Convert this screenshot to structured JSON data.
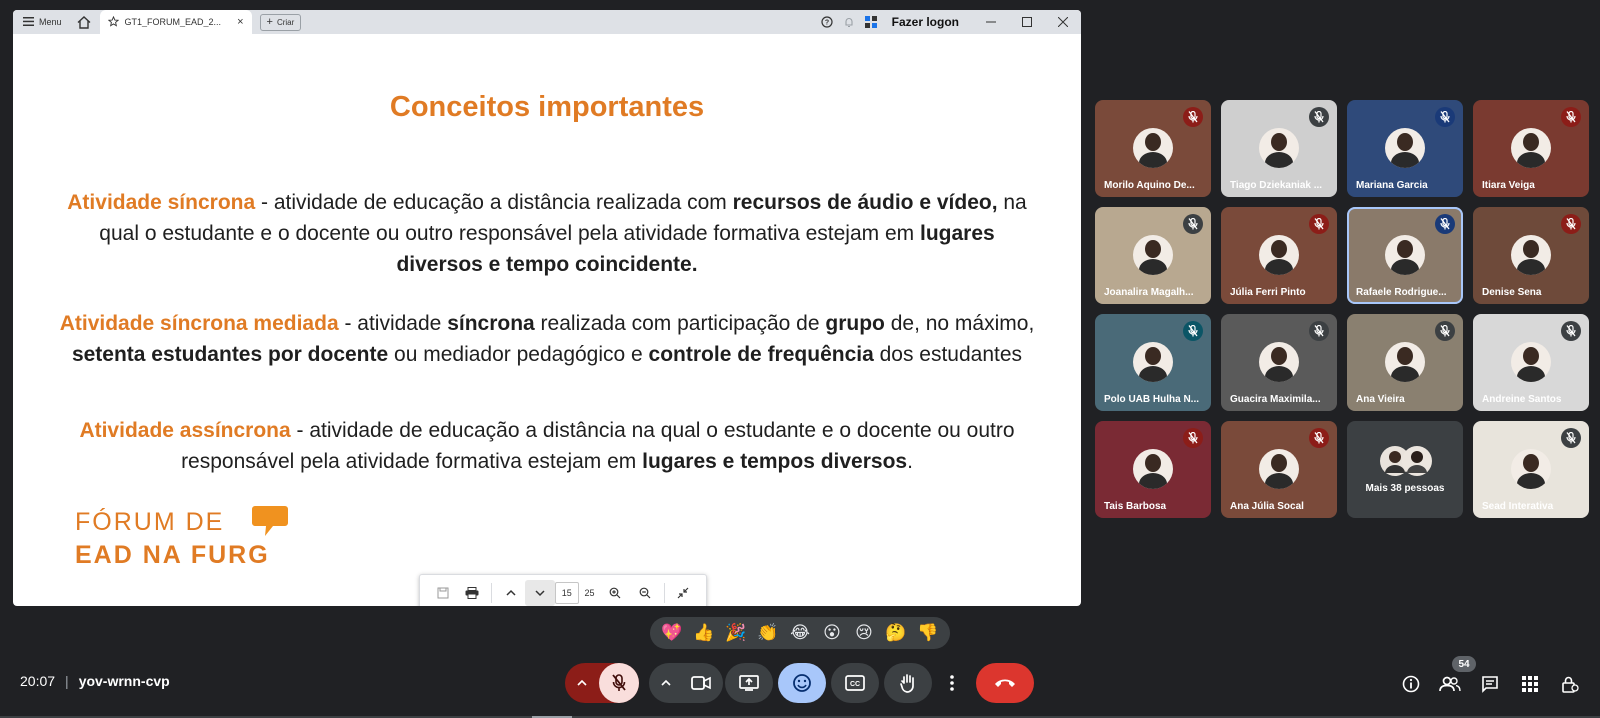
{
  "browser": {
    "menu_label": "Menu",
    "tab_title": "GT1_FORUM_EAD_2...",
    "new_label": "Criar",
    "login_label": "Fazer logon"
  },
  "slide": {
    "title": "Conceitos importantes",
    "p1": {
      "term": "Atividade síncrona",
      "t1": " - atividade de educação a distância realizada com ",
      "b1": "recursos de áudio e vídeo,",
      "t2": " na qual o estudante e o docente ou outro responsável pela atividade formativa estejam em ",
      "b2": "lugares diversos e tempo coincidente."
    },
    "p2": {
      "term": "Atividade síncrona mediada",
      "t1": " - atividade ",
      "b1": "síncrona",
      "t2": " realizada com participação de ",
      "b2": "grupo",
      "t3": " de, no máximo, ",
      "b3": "setenta estudantes por docente",
      "t4": " ou mediador pedagógico e ",
      "b4": "controle de frequência",
      "t5": " dos estudantes"
    },
    "p3": {
      "term": "Atividade assíncrona",
      "t1": " - atividade de educação a distância na qual o estudante e o docente ou outro responsável pela atividade formativa estejam em ",
      "b1": "lugares e tempos diversos",
      "t2": "."
    },
    "logo_line1": "FÓRUM DE",
    "logo_line2": "EAD NA FURG"
  },
  "pdf_toolbar": {
    "page": "15",
    "total": "25"
  },
  "participants": [
    {
      "name": "Morilo Aquino De...",
      "bg": "#7a4a3a",
      "mute_color": "#8c1d18"
    },
    {
      "name": "Tiago Dziekaniak ...",
      "bg": "#cfcfcf",
      "mute_color": "#3c4043"
    },
    {
      "name": "Mariana Garcia",
      "bg": "#2f4a7a",
      "mute_color": "#1a3a78"
    },
    {
      "name": "Itiara Veiga",
      "bg": "#7a3a30",
      "mute_color": "#8c1d18"
    },
    {
      "name": "Joanalira Magalh...",
      "bg": "#b8a890",
      "mute_color": "#3c4043"
    },
    {
      "name": "Júlia Ferri Pinto",
      "bg": "#7a4a3a",
      "mute_color": "#8c1d18"
    },
    {
      "name": "Rafaele Rodrigue...",
      "bg": "#8a7a6a",
      "mute_color": "#1a3a78"
    },
    {
      "name": "Denise Sena",
      "bg": "#6e4a3a",
      "mute_color": "#8c1d18"
    },
    {
      "name": "Polo UAB Hulha N...",
      "bg": "#4a6a78",
      "mute_color": "#0b5566"
    },
    {
      "name": "Guacira Maximila...",
      "bg": "#5a5a5a",
      "mute_color": "#3c4043"
    },
    {
      "name": "Ana Vieira",
      "bg": "#8a8070",
      "mute_color": "#3c4043"
    },
    {
      "name": "Andreine Santos",
      "bg": "#d8d8d8",
      "mute_color": "#3c4043"
    },
    {
      "name": "Tais Barbosa",
      "bg": "#7a2a34",
      "mute_color": "#8c1d18"
    },
    {
      "name": "Ana Júlia Socal",
      "bg": "#7a4a3a",
      "mute_color": "#8c1d18"
    },
    {
      "name": "Sead Interativa",
      "bg": "#e8e4dc",
      "mute_color": "#3c4043"
    }
  ],
  "more_people": "Mais 38 pessoas",
  "reactions": [
    "💖",
    "👍",
    "🎉",
    "👏",
    "😂",
    "😮",
    "😢",
    "🤔",
    "👎"
  ],
  "meeting": {
    "time": "20:07",
    "code": "yov-wrnn-cvp",
    "people_count": "54"
  }
}
